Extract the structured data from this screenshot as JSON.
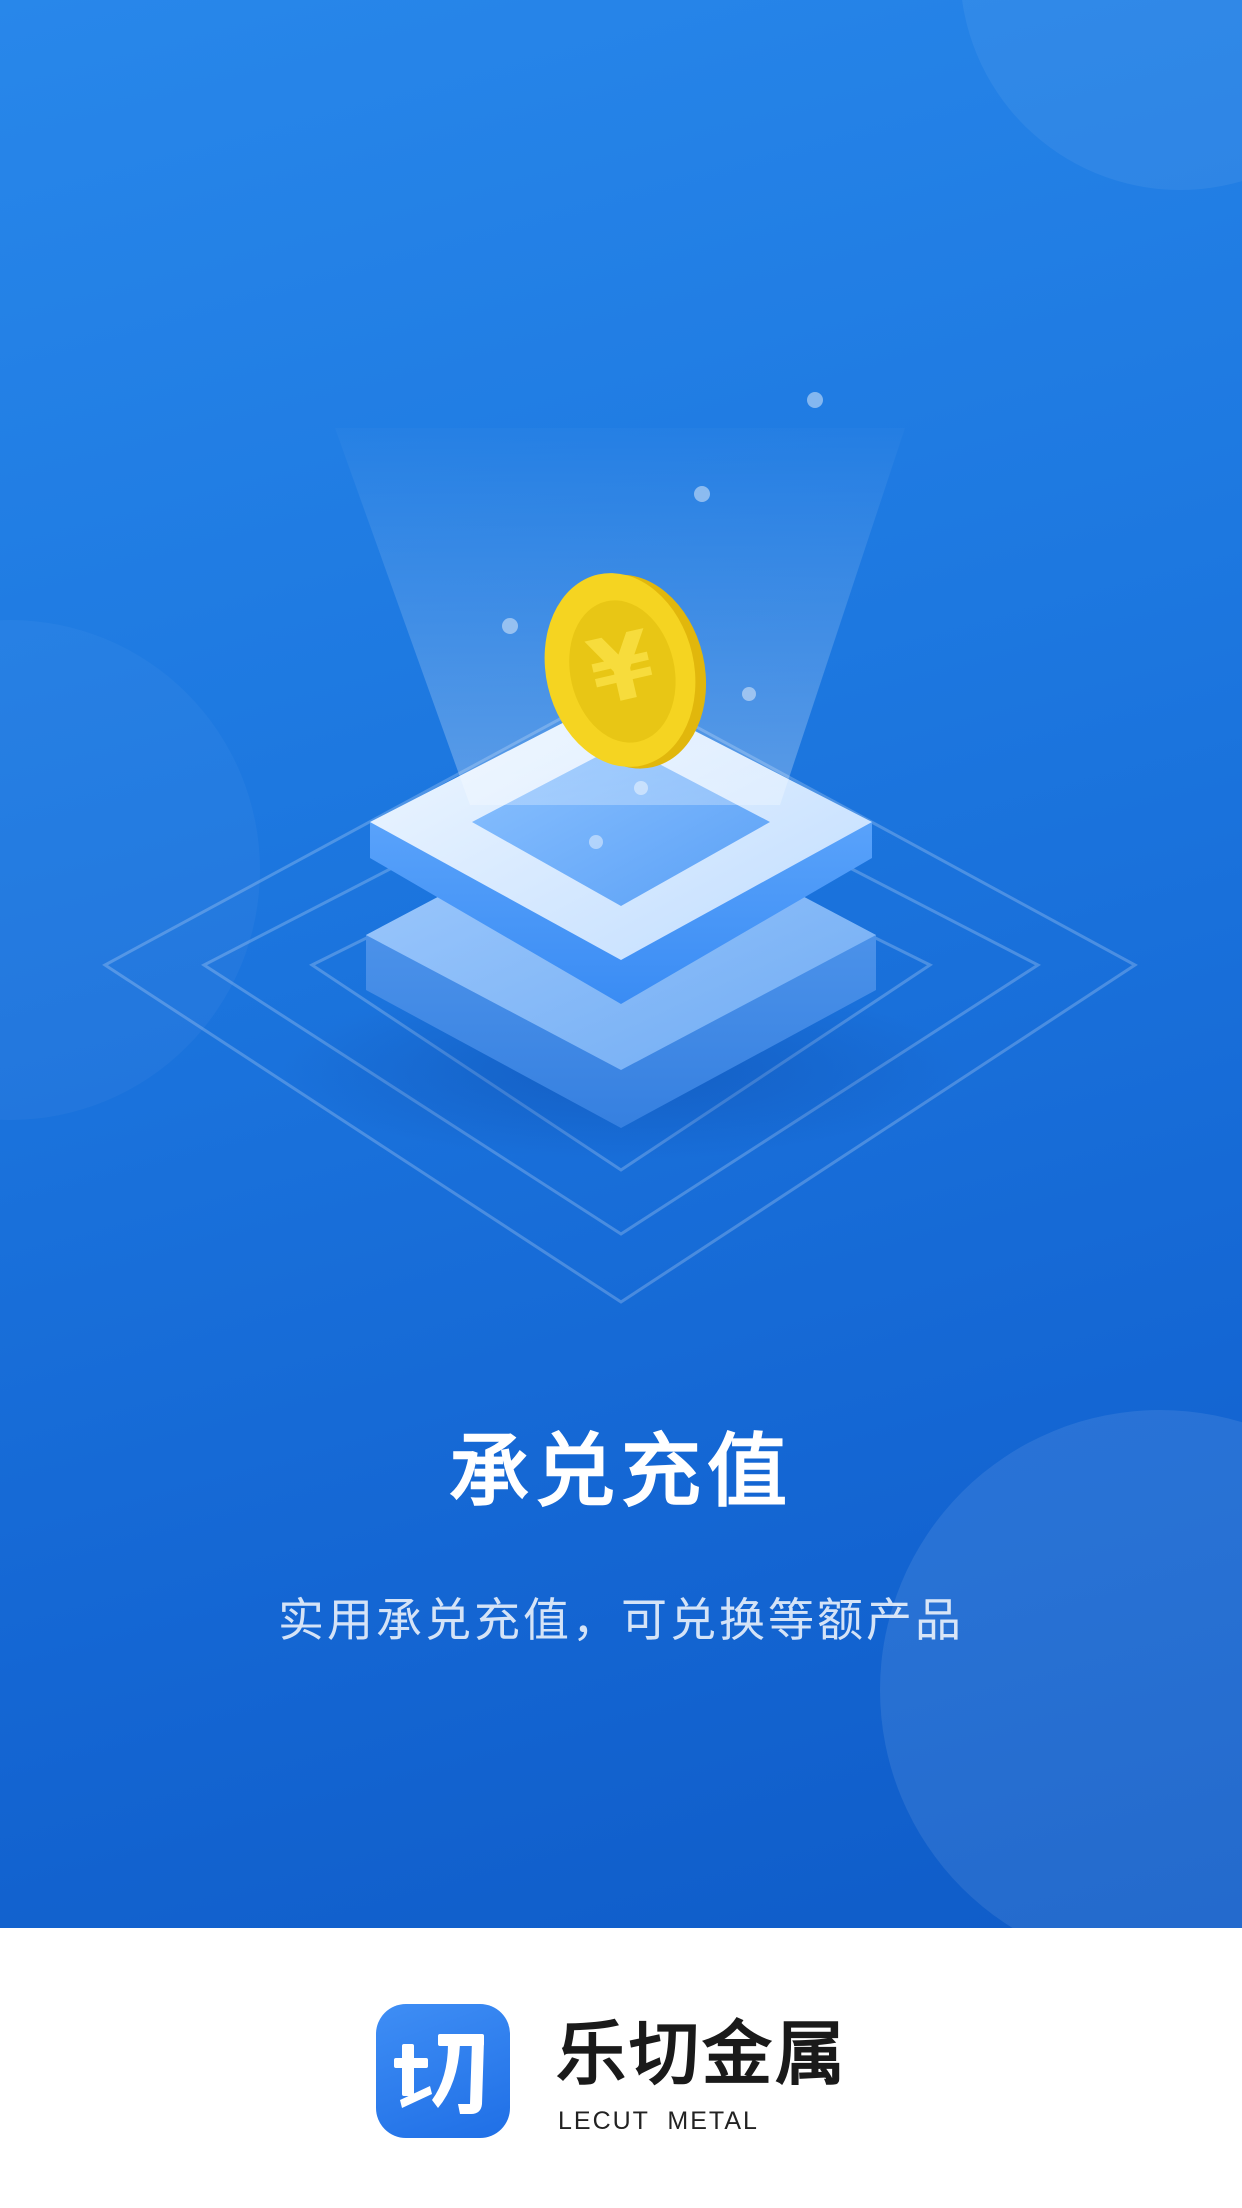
{
  "hero": {
    "title": "承兑充值",
    "subtitle": "实用承兑充值，可兑换等额产品",
    "illustration": {
      "icon": "coin-on-stacked-platform-icon",
      "coin_symbol": "¥",
      "colors": {
        "background_top": "#2887ea",
        "background_bottom": "#0f5cc8",
        "coin": "#f5d421",
        "platform": "#d8ebff"
      }
    }
  },
  "brand": {
    "logo_icon": "lecut-logo-icon",
    "name": "乐切金属",
    "subname": "LECUT  METAL",
    "color": "#2a77ee"
  }
}
